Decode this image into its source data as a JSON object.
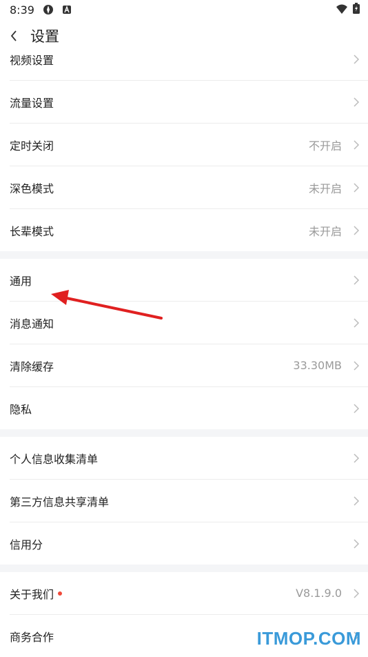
{
  "status_bar": {
    "time": "8:39"
  },
  "header": {
    "title": "设置"
  },
  "groups": [
    [
      {
        "label": "视频设置",
        "value": ""
      },
      {
        "label": "流量设置",
        "value": ""
      },
      {
        "label": "定时关闭",
        "value": "不开启"
      },
      {
        "label": "深色模式",
        "value": "未开启"
      },
      {
        "label": "长辈模式",
        "value": "未开启"
      }
    ],
    [
      {
        "label": "通用",
        "value": ""
      },
      {
        "label": "消息通知",
        "value": ""
      },
      {
        "label": "清除缓存",
        "value": "33.30MB"
      },
      {
        "label": "隐私",
        "value": ""
      }
    ],
    [
      {
        "label": "个人信息收集清单",
        "value": ""
      },
      {
        "label": "第三方信息共享清单",
        "value": ""
      },
      {
        "label": "信用分",
        "value": ""
      }
    ],
    [
      {
        "label": "关于我们",
        "value": "V8.1.9.0"
      },
      {
        "label": "商务合作",
        "value": ""
      }
    ]
  ],
  "watermark": "ITMOP.COM",
  "colors": {
    "arrow": "#e02020",
    "badge": "#f04a3a",
    "watermark": "#3a9ad9"
  }
}
